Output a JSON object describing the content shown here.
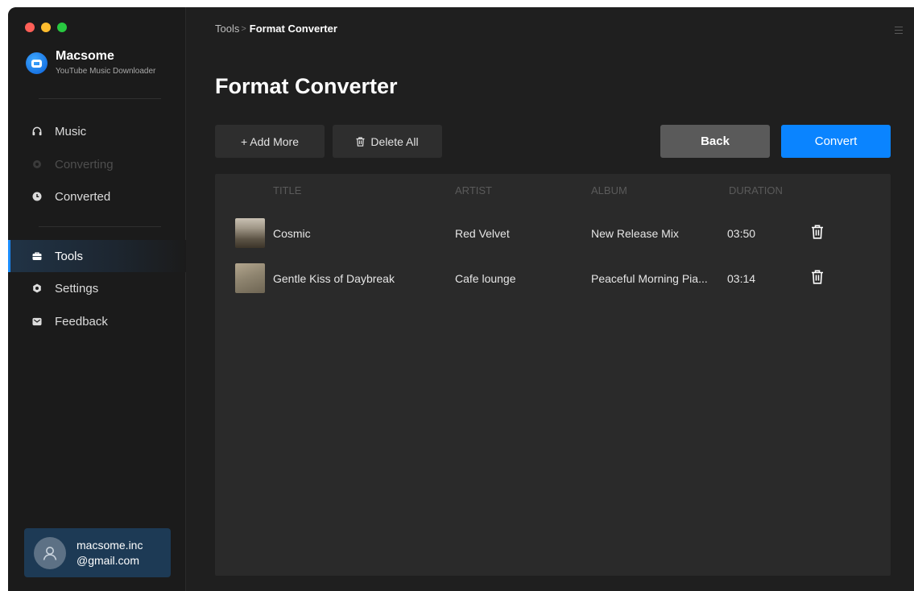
{
  "window": {
    "traffic_lights": [
      "#ff5f57",
      "#febc2e",
      "#28c840"
    ]
  },
  "brand": {
    "name": "Macsome",
    "subtitle": "YouTube Music Downloader",
    "icon": "macsome-logo-icon"
  },
  "sidebar": {
    "items": [
      {
        "label": "Music",
        "icon": "headphones-icon",
        "state": "normal"
      },
      {
        "label": "Converting",
        "icon": "converting-icon",
        "state": "disabled"
      },
      {
        "label": "Converted",
        "icon": "clock-icon",
        "state": "normal"
      },
      {
        "label": "Tools",
        "icon": "toolbox-icon",
        "state": "active"
      },
      {
        "label": "Settings",
        "icon": "gear-icon",
        "state": "normal"
      },
      {
        "label": "Feedback",
        "icon": "mail-icon",
        "state": "normal"
      }
    ],
    "account": {
      "line1": "macsome.inc",
      "line2": "@gmail.com",
      "icon": "user-avatar-icon"
    }
  },
  "breadcrumb": {
    "root": "Tools",
    "separator": ">",
    "current": "Format Converter"
  },
  "page_title": "Format Converter",
  "toolbar": {
    "add_more": "+ Add More",
    "delete_all": "Delete All",
    "back": "Back",
    "convert": "Convert"
  },
  "table": {
    "headers": {
      "title": "TITLE",
      "artist": "ARTIST",
      "album": "ALBUM",
      "duration": "DURATION"
    },
    "rows": [
      {
        "title": "Cosmic",
        "artist": "Red Velvet",
        "album": "New Release Mix",
        "duration": "03:50"
      },
      {
        "title": "Gentle Kiss of Daybreak",
        "artist": "Cafe lounge",
        "album": "Peaceful Morning Pia...",
        "duration": "03:14"
      }
    ]
  },
  "colors": {
    "accent": "#0a84ff",
    "active_nav_bar": "#1a8cff",
    "back_button": "#5a5a5a",
    "account_card": "#1d3a55"
  }
}
